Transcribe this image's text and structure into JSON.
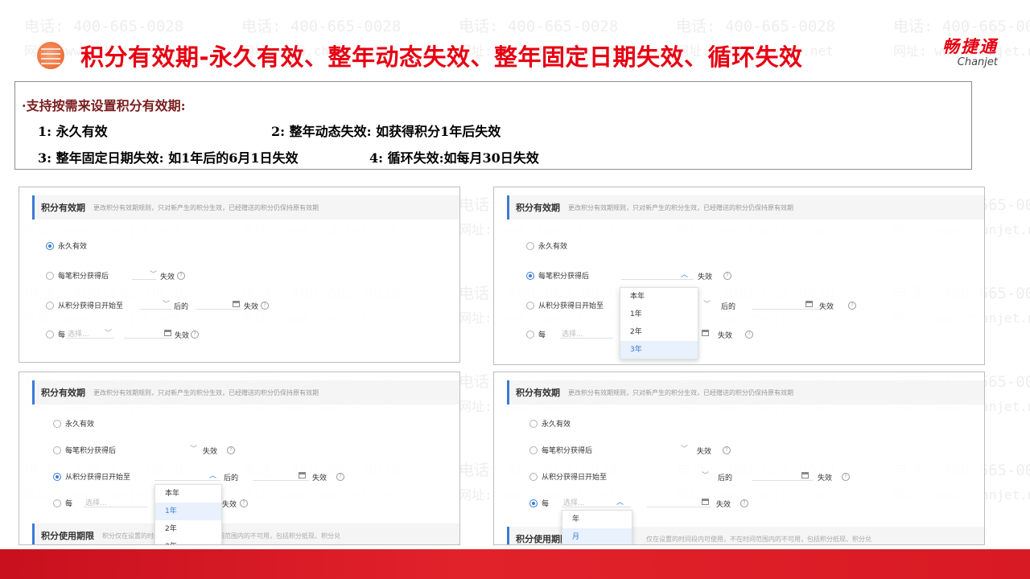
{
  "slide": {
    "title": "积分有效期-永久有效、整年动态失效、整年固定日期失效、循环失效"
  },
  "logo": {
    "cn": "畅捷通",
    "en": "Chanjet"
  },
  "watermark": {
    "phone": "电话: 400-665-0028",
    "url": "网址: www.chanjet.net"
  },
  "intro": {
    "heading": "·支持按需来设置积分有效期:",
    "items": [
      "1:  永久有效",
      "2:  整年动态失效:  如获得积分1年后失效",
      "3:  整年固定日期失效:  如1年后的6月1日失效",
      "4:  循环失效:如每月30日失效"
    ]
  },
  "panel": {
    "title": "积分有效期",
    "description": "更改积分有效期规则，只对新产生的积分生效，已经赠送的积分仍保持原有效期",
    "options": {
      "permanent": "永久有效",
      "per_gain": "每笔积分获得后",
      "from_date": "从积分获得日开始至",
      "every": "每"
    },
    "expire": "失效",
    "after": "后的",
    "select_placeholder": "选择...",
    "usage_title": "积分使用期限",
    "usage_desc_a": "积分仅在设置的时间段内可使用，不在时间范围内的不可用，包括积分抵现、积分兑",
    "usage_desc_b": "仅在设置的时间段内可使用，不在时间范围内的不可用，包括积分抵现、积分兑"
  },
  "dropdowns": {
    "years": [
      "本年",
      "1年",
      "2年",
      "3年"
    ],
    "cycle": [
      "年",
      "月"
    ]
  },
  "colors": {
    "brand_red": "#e60012",
    "accent_blue": "#3a7bd5"
  },
  "icons": {
    "bullet": "globe-bullet-icon",
    "calendar": "calendar-icon",
    "help": "help-circle-icon"
  }
}
